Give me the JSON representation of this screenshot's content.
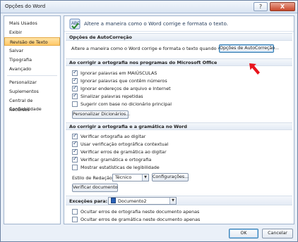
{
  "window": {
    "title": "Opções do Word",
    "help_glyph": "?",
    "close_glyph": "X"
  },
  "sidebar": {
    "items": [
      {
        "label": "Mais Usados"
      },
      {
        "label": "Exibir"
      },
      {
        "label": "Revisão de Texto",
        "active": true
      },
      {
        "label": "Salvar"
      },
      {
        "label": "Tipografia"
      },
      {
        "label": "Avançado"
      },
      {
        "label": "Personalizar"
      },
      {
        "label": "Suplementos"
      },
      {
        "label": "Central de Confiabilidade"
      },
      {
        "label": "Recursos"
      }
    ]
  },
  "header": {
    "text": "Altere a maneira como o Word corrige e formata o texto."
  },
  "autocorrect": {
    "section": "Opções de AutoCorreção",
    "description": "Altere a maneira como o Word corrige e formata o texto quando você digita:",
    "button": "Opções de AutoCorreção..."
  },
  "office_spelling": {
    "section": "Ao corrigir a ortografia nos programas do Microsoft Office",
    "options": [
      {
        "label": "Ignorar palavras em MAIÚSCULAS",
        "checked": true
      },
      {
        "label": "Ignorar palavras que contêm números",
        "checked": true
      },
      {
        "label": "Ignorar endereços de arquivo e Internet",
        "checked": true
      },
      {
        "label": "Sinalizar palavras repetidas",
        "checked": true
      },
      {
        "label": "Sugerir com base no dicionário principal",
        "checked": false
      }
    ],
    "dictionaries_button": "Personalizar Dicionários..."
  },
  "word_spelling": {
    "section": "Ao corrigir a ortografia e a gramática no Word",
    "options": [
      {
        "label": "Verificar ortografia ao digitar",
        "checked": true
      },
      {
        "label": "Usar verificação ortográfica contextual",
        "checked": true
      },
      {
        "label": "Verificar erros de gramática ao digitar",
        "checked": true
      },
      {
        "label": "Verificar gramática e ortografia",
        "checked": true
      },
      {
        "label": "Mostrar estatísticas de legibilidade",
        "checked": false
      }
    ],
    "writing_style_label": "Estilo de Redação:",
    "writing_style_value": "Técnico",
    "settings_button": "Configurações...",
    "check_document_button": "Verificar documento"
  },
  "exceptions": {
    "label": "Exceções para:",
    "document": "Documento2",
    "options": [
      {
        "label": "Ocultar erros de ortografia neste documento apenas",
        "checked": false
      },
      {
        "label": "Ocultar erros de gramática neste documento apenas",
        "checked": false
      }
    ]
  },
  "footer": {
    "ok": "OK",
    "cancel": "Cancelar"
  },
  "checkmark": "✓",
  "arrow_glyph": "▼",
  "colors": {
    "accent_arrow": "#e8141c",
    "active_item": "#ffc867"
  }
}
